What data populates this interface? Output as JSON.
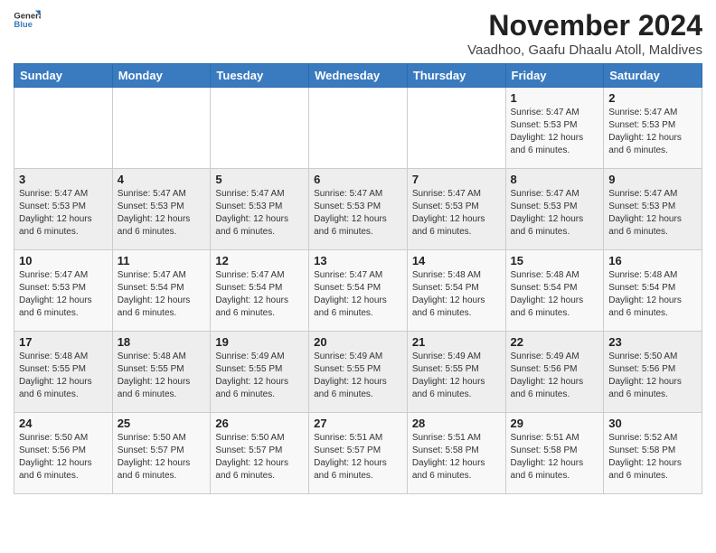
{
  "header": {
    "logo_general": "General",
    "logo_blue": "Blue",
    "title": "November 2024",
    "location": "Vaadhoo, Gaafu Dhaalu Atoll, Maldives"
  },
  "calendar": {
    "days_of_week": [
      "Sunday",
      "Monday",
      "Tuesday",
      "Wednesday",
      "Thursday",
      "Friday",
      "Saturday"
    ],
    "weeks": [
      [
        {
          "day": "",
          "info": ""
        },
        {
          "day": "",
          "info": ""
        },
        {
          "day": "",
          "info": ""
        },
        {
          "day": "",
          "info": ""
        },
        {
          "day": "",
          "info": ""
        },
        {
          "day": "1",
          "info": "Sunrise: 5:47 AM\nSunset: 5:53 PM\nDaylight: 12 hours and 6 minutes."
        },
        {
          "day": "2",
          "info": "Sunrise: 5:47 AM\nSunset: 5:53 PM\nDaylight: 12 hours and 6 minutes."
        }
      ],
      [
        {
          "day": "3",
          "info": "Sunrise: 5:47 AM\nSunset: 5:53 PM\nDaylight: 12 hours and 6 minutes."
        },
        {
          "day": "4",
          "info": "Sunrise: 5:47 AM\nSunset: 5:53 PM\nDaylight: 12 hours and 6 minutes."
        },
        {
          "day": "5",
          "info": "Sunrise: 5:47 AM\nSunset: 5:53 PM\nDaylight: 12 hours and 6 minutes."
        },
        {
          "day": "6",
          "info": "Sunrise: 5:47 AM\nSunset: 5:53 PM\nDaylight: 12 hours and 6 minutes."
        },
        {
          "day": "7",
          "info": "Sunrise: 5:47 AM\nSunset: 5:53 PM\nDaylight: 12 hours and 6 minutes."
        },
        {
          "day": "8",
          "info": "Sunrise: 5:47 AM\nSunset: 5:53 PM\nDaylight: 12 hours and 6 minutes."
        },
        {
          "day": "9",
          "info": "Sunrise: 5:47 AM\nSunset: 5:53 PM\nDaylight: 12 hours and 6 minutes."
        }
      ],
      [
        {
          "day": "10",
          "info": "Sunrise: 5:47 AM\nSunset: 5:53 PM\nDaylight: 12 hours and 6 minutes."
        },
        {
          "day": "11",
          "info": "Sunrise: 5:47 AM\nSunset: 5:54 PM\nDaylight: 12 hours and 6 minutes."
        },
        {
          "day": "12",
          "info": "Sunrise: 5:47 AM\nSunset: 5:54 PM\nDaylight: 12 hours and 6 minutes."
        },
        {
          "day": "13",
          "info": "Sunrise: 5:47 AM\nSunset: 5:54 PM\nDaylight: 12 hours and 6 minutes."
        },
        {
          "day": "14",
          "info": "Sunrise: 5:48 AM\nSunset: 5:54 PM\nDaylight: 12 hours and 6 minutes."
        },
        {
          "day": "15",
          "info": "Sunrise: 5:48 AM\nSunset: 5:54 PM\nDaylight: 12 hours and 6 minutes."
        },
        {
          "day": "16",
          "info": "Sunrise: 5:48 AM\nSunset: 5:54 PM\nDaylight: 12 hours and 6 minutes."
        }
      ],
      [
        {
          "day": "17",
          "info": "Sunrise: 5:48 AM\nSunset: 5:55 PM\nDaylight: 12 hours and 6 minutes."
        },
        {
          "day": "18",
          "info": "Sunrise: 5:48 AM\nSunset: 5:55 PM\nDaylight: 12 hours and 6 minutes."
        },
        {
          "day": "19",
          "info": "Sunrise: 5:49 AM\nSunset: 5:55 PM\nDaylight: 12 hours and 6 minutes."
        },
        {
          "day": "20",
          "info": "Sunrise: 5:49 AM\nSunset: 5:55 PM\nDaylight: 12 hours and 6 minutes."
        },
        {
          "day": "21",
          "info": "Sunrise: 5:49 AM\nSunset: 5:55 PM\nDaylight: 12 hours and 6 minutes."
        },
        {
          "day": "22",
          "info": "Sunrise: 5:49 AM\nSunset: 5:56 PM\nDaylight: 12 hours and 6 minutes."
        },
        {
          "day": "23",
          "info": "Sunrise: 5:50 AM\nSunset: 5:56 PM\nDaylight: 12 hours and 6 minutes."
        }
      ],
      [
        {
          "day": "24",
          "info": "Sunrise: 5:50 AM\nSunset: 5:56 PM\nDaylight: 12 hours and 6 minutes."
        },
        {
          "day": "25",
          "info": "Sunrise: 5:50 AM\nSunset: 5:57 PM\nDaylight: 12 hours and 6 minutes."
        },
        {
          "day": "26",
          "info": "Sunrise: 5:50 AM\nSunset: 5:57 PM\nDaylight: 12 hours and 6 minutes."
        },
        {
          "day": "27",
          "info": "Sunrise: 5:51 AM\nSunset: 5:57 PM\nDaylight: 12 hours and 6 minutes."
        },
        {
          "day": "28",
          "info": "Sunrise: 5:51 AM\nSunset: 5:58 PM\nDaylight: 12 hours and 6 minutes."
        },
        {
          "day": "29",
          "info": "Sunrise: 5:51 AM\nSunset: 5:58 PM\nDaylight: 12 hours and 6 minutes."
        },
        {
          "day": "30",
          "info": "Sunrise: 5:52 AM\nSunset: 5:58 PM\nDaylight: 12 hours and 6 minutes."
        }
      ]
    ]
  }
}
